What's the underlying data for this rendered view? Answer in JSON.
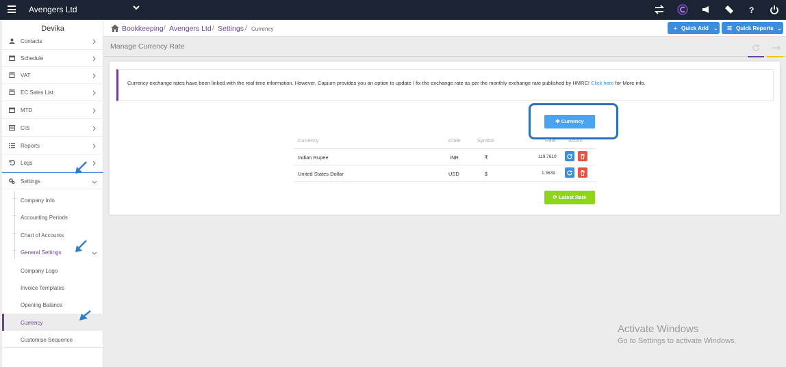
{
  "topbar": {
    "company": "Avengers Ltd"
  },
  "sidebar": {
    "user": "Devika",
    "items": [
      {
        "label": "Contacts"
      },
      {
        "label": "Schedule"
      },
      {
        "label": "VAT"
      },
      {
        "label": "EC Sales List"
      },
      {
        "label": "MTD"
      },
      {
        "label": "CIS"
      },
      {
        "label": "Reports"
      },
      {
        "label": "Logs"
      },
      {
        "label": "Settings"
      }
    ],
    "settings_sub": [
      {
        "label": "Company Info"
      },
      {
        "label": "Accounting Periods"
      },
      {
        "label": "Chart of Accounts"
      },
      {
        "label": "General Settings"
      }
    ],
    "general_sub": [
      {
        "label": "Company Logo"
      },
      {
        "label": "Invoice Templates"
      },
      {
        "label": "Opening Balance"
      },
      {
        "label": "Currency"
      },
      {
        "label": "Customise Sequence"
      }
    ]
  },
  "breadcrumb": {
    "b1": "Bookkeeping",
    "b2": "Avengers Ltd",
    "b3": "Settings",
    "current": "Currency",
    "sep": "/"
  },
  "header_buttons": {
    "quick_add": "Quick Add",
    "quick_reports": "Quick Reports"
  },
  "page": {
    "title": "Manage Currency Rate"
  },
  "notice": {
    "text": "Currency exchange rates have been linked with the real time information. However, Capium provides you an option to update / fix the exchange rate as per the monthly exchange rate published by HMRC!",
    "link": "Click here",
    "tail": "for More info."
  },
  "add_button": "Currency",
  "table": {
    "headers": {
      "currency": "Currency",
      "code": "Code",
      "symbol": "Symbol",
      "rate": "Rate",
      "action": "Action"
    },
    "rows": [
      {
        "currency": "Indian Rupee",
        "code": "INR",
        "symbol": "₹",
        "rate": "119.7610"
      },
      {
        "currency": "United States Dollar",
        "code": "USD",
        "symbol": "$",
        "rate": "1.3639"
      }
    ]
  },
  "latest_button": "Latest Rate",
  "watermark": {
    "line1": "Activate Windows",
    "line2": "Go to Settings to activate Windows."
  },
  "colors": {
    "topbar": "#1b2433",
    "accent": "#6b3fa0",
    "primary": "#3c8dde",
    "success": "#8fd31d",
    "danger": "#e8523f"
  }
}
